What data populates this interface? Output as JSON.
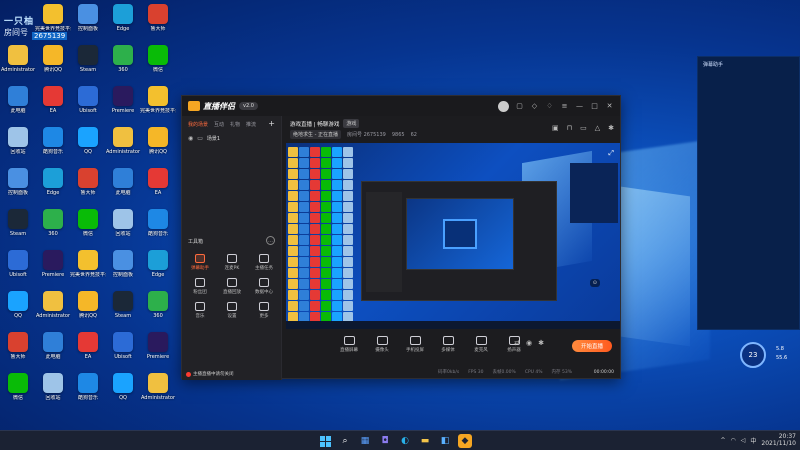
{
  "desktop": {
    "overlay": {
      "line1": "一只柚",
      "line2": "房间号",
      "room": "2675139"
    },
    "icons": [
      {
        "label": "Administrator",
        "color": "#f0c040"
      },
      {
        "label": "此电脑",
        "color": "#2f7fd8"
      },
      {
        "label": "回收站",
        "color": "#9ec4e8"
      },
      {
        "label": "控制面板",
        "color": "#4a90e2"
      },
      {
        "label": "Steam",
        "color": "#1b2838"
      },
      {
        "label": "Ubisoft",
        "color": "#2c6bd6"
      },
      {
        "label": "QQ",
        "color": "#1aa3ff"
      },
      {
        "label": "鲁大师",
        "color": "#d9412f"
      },
      {
        "label": "微信",
        "color": "#09bb07"
      },
      {
        "label": "完美世界竞技平台",
        "color": "#f3c02e"
      },
      {
        "label": "腾讯QQ",
        "color": "#f5b728"
      },
      {
        "label": "EA",
        "color": "#e53935"
      },
      {
        "label": "酷狗音乐",
        "color": "#1e88e5"
      },
      {
        "label": "Edge",
        "color": "#1c9fd8"
      },
      {
        "label": "360",
        "color": "#2db04b"
      },
      {
        "label": "Premiere",
        "color": "#2a1a5e"
      }
    ]
  },
  "right_panel": {
    "label": "弹幕助手"
  },
  "weather": {
    "temp": "23",
    "line1": "5.8",
    "line2": "55.6"
  },
  "app": {
    "title": "直播伴侣",
    "version": "v2.0",
    "sidebar": {
      "tabs": [
        "我的场景",
        "互动",
        "礼物",
        "推流"
      ],
      "scene": "场景1",
      "tools_title": "工具箱",
      "tools": [
        {
          "label": "弹幕助手",
          "hot": true
        },
        {
          "label": "连麦PK",
          "hot": false
        },
        {
          "label": "主播任务",
          "hot": false
        },
        {
          "label": "粉丝团",
          "hot": false
        },
        {
          "label": "直播回放",
          "hot": false
        },
        {
          "label": "数据中心",
          "hot": false
        },
        {
          "label": "音乐",
          "hot": false
        },
        {
          "label": "设置",
          "hot": false
        },
        {
          "label": "更多",
          "hot": false
        }
      ],
      "warning": "主播直播中请勿关闭"
    },
    "roominfo": {
      "headline": "游戏直播 | 畅聊游戏",
      "tag": "游戏",
      "category": "绝地求生 - 正在直播",
      "room_no": "房间号 2675139",
      "fans": "9865",
      "viewers": "62"
    },
    "controls": [
      {
        "label": "直播屏幕"
      },
      {
        "label": "摄像头"
      },
      {
        "label": "手机投屏"
      },
      {
        "label": "多媒体"
      },
      {
        "label": "麦克风"
      },
      {
        "label": "扬声器"
      }
    ],
    "golive_label": "开始直播",
    "status": [
      "码率0kb/s",
      "FPS 30",
      "丢帧0.00%",
      "CPU 4%",
      "内存 53%"
    ],
    "clock": "00:00:00"
  },
  "taskbar": {
    "tray": [
      "^",
      "中",
      "20:37",
      "2021/11/10"
    ]
  }
}
